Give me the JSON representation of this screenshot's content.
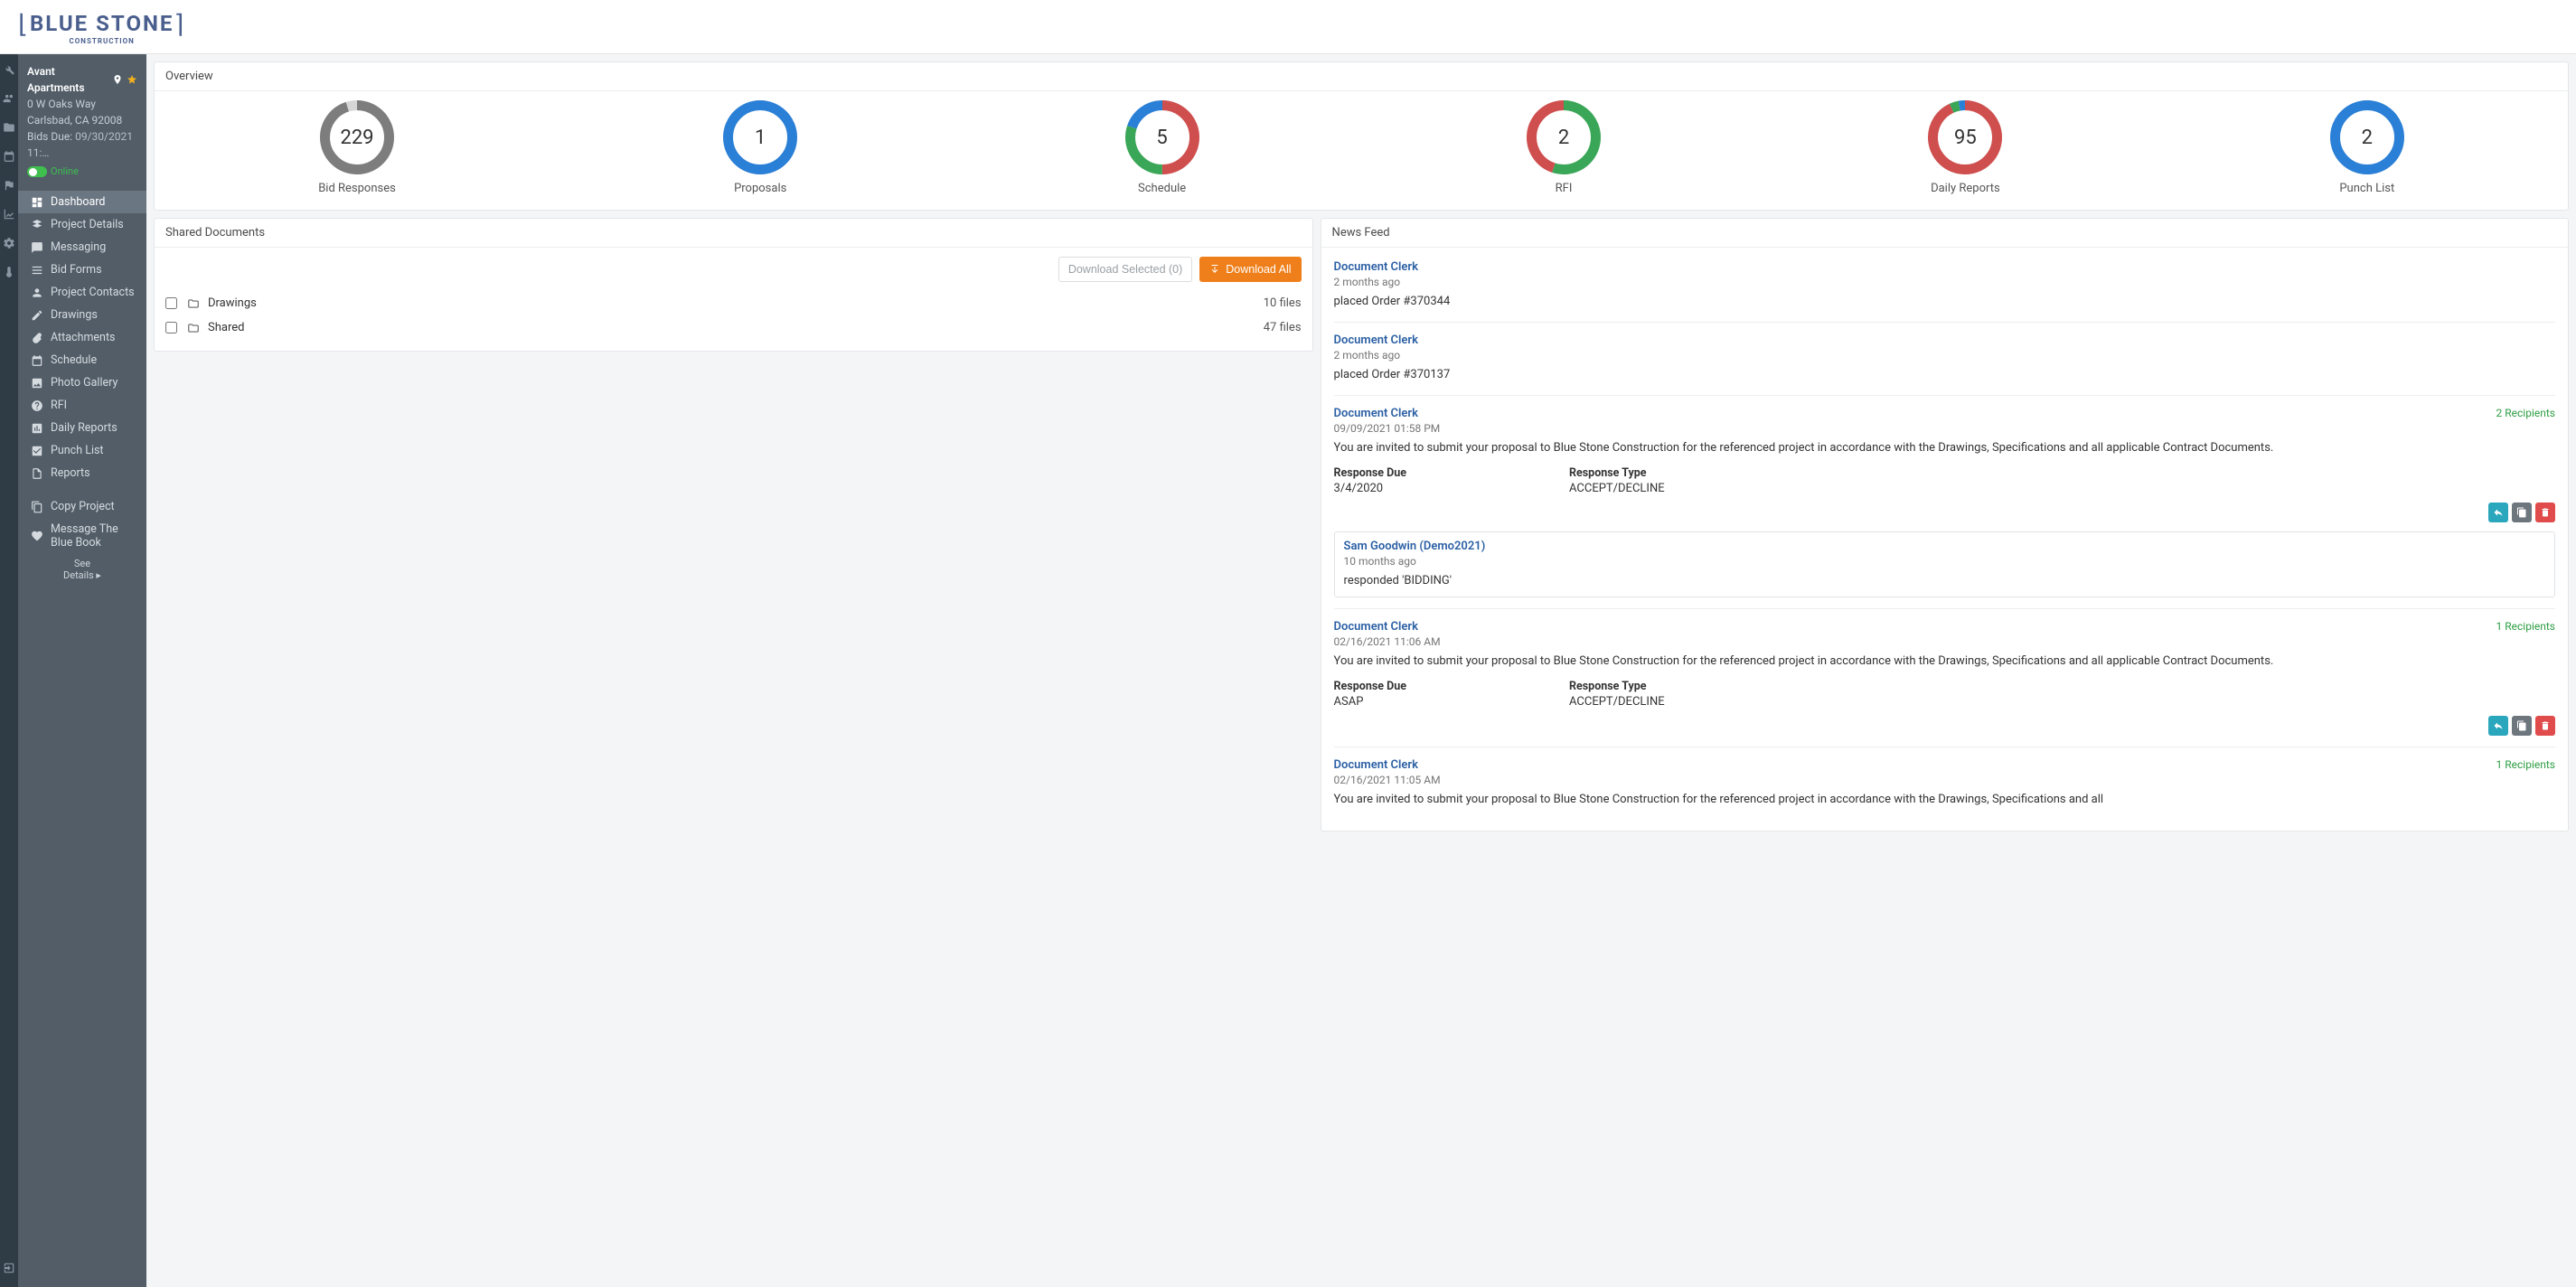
{
  "header": {
    "logo_main": "BLUE STONE",
    "logo_sub": "CONSTRUCTION"
  },
  "project": {
    "name": "Avant Apartments",
    "address1": "0 W Oaks Way",
    "address2": "Carlsbad, CA 92008",
    "bids_due_label": "Bids Due:",
    "bids_due_value": "09/30/2021 11:…",
    "online_label": "Online"
  },
  "nav": [
    {
      "id": "dashboard",
      "label": "Dashboard",
      "active": true
    },
    {
      "id": "project-details",
      "label": "Project Details"
    },
    {
      "id": "messaging",
      "label": "Messaging"
    },
    {
      "id": "bid-forms",
      "label": "Bid Forms"
    },
    {
      "id": "project-contacts",
      "label": "Project Contacts"
    },
    {
      "id": "drawings",
      "label": "Drawings"
    },
    {
      "id": "attachments",
      "label": "Attachments"
    },
    {
      "id": "schedule",
      "label": "Schedule"
    },
    {
      "id": "photo-gallery",
      "label": "Photo Gallery"
    },
    {
      "id": "rfi",
      "label": "RFI"
    },
    {
      "id": "daily-reports",
      "label": "Daily Reports"
    },
    {
      "id": "punch-list",
      "label": "Punch List"
    },
    {
      "id": "reports",
      "label": "Reports"
    }
  ],
  "nav_extra": [
    {
      "id": "copy-project",
      "label": "Copy Project"
    },
    {
      "id": "message-bluebook",
      "label": "Message The Blue Book"
    }
  ],
  "see_details": {
    "line1": "See",
    "line2": "Details ▸"
  },
  "overview": {
    "title": "Overview",
    "items": [
      {
        "value": "229",
        "label": "Bid Responses",
        "segments": [
          {
            "color": "#7d7d7d",
            "pct": 95
          },
          {
            "color": "#d6d6d6",
            "pct": 5
          }
        ]
      },
      {
        "value": "1",
        "label": "Proposals",
        "segments": [
          {
            "color": "#2a7fd6",
            "pct": 100
          }
        ]
      },
      {
        "value": "5",
        "label": "Schedule",
        "segments": [
          {
            "color": "#cf4e4e",
            "pct": 50
          },
          {
            "color": "#3aa657",
            "pct": 30
          },
          {
            "color": "#2a7fd6",
            "pct": 20
          }
        ]
      },
      {
        "value": "2",
        "label": "RFI",
        "segments": [
          {
            "color": "#3aa657",
            "pct": 55
          },
          {
            "color": "#cf4e4e",
            "pct": 45
          }
        ]
      },
      {
        "value": "95",
        "label": "Daily Reports",
        "segments": [
          {
            "color": "#cf4e4e",
            "pct": 93
          },
          {
            "color": "#3aa657",
            "pct": 4
          },
          {
            "color": "#2a7fd6",
            "pct": 3
          }
        ]
      },
      {
        "value": "2",
        "label": "Punch List",
        "segments": [
          {
            "color": "#2a7fd6",
            "pct": 100
          }
        ]
      }
    ]
  },
  "shared_docs": {
    "title": "Shared Documents",
    "download_selected": "Download Selected (0)",
    "download_all": "Download All",
    "rows": [
      {
        "name": "Drawings",
        "count": "10 files"
      },
      {
        "name": "Shared",
        "count": "47 files"
      }
    ]
  },
  "news_feed": {
    "title": "News Feed",
    "items": [
      {
        "author": "Document Clerk",
        "time": "2 months ago",
        "body": "placed Order #370344"
      },
      {
        "author": "Document Clerk",
        "time": "2 months ago",
        "body": "placed Order #370137"
      },
      {
        "author": "Document Clerk",
        "time": "09/09/2021 01:58 PM",
        "recipients": "2 Recipients",
        "body": "You are invited to submit your proposal to Blue Stone Construction for the referenced project in accordance with the Drawings, Specifications and all applicable Contract Documents.",
        "response_due_label": "Response Due",
        "response_due": "3/4/2020",
        "response_type_label": "Response Type",
        "response_type": "ACCEPT/DECLINE",
        "actions": true,
        "reply": {
          "author": "Sam Goodwin (Demo2021)",
          "time": "10 months ago",
          "body": "responded 'BIDDING'"
        }
      },
      {
        "author": "Document Clerk",
        "time": "02/16/2021 11:06 AM",
        "recipients": "1 Recipients",
        "body": "You are invited to submit your proposal to Blue Stone Construction for the referenced project in accordance with the Drawings, Specifications and all applicable Contract Documents.",
        "response_due_label": "Response Due",
        "response_due": "ASAP",
        "response_type_label": "Response Type",
        "response_type": "ACCEPT/DECLINE",
        "actions": true
      },
      {
        "author": "Document Clerk",
        "time": "02/16/2021 11:05 AM",
        "recipients": "1 Recipients",
        "body": "You are invited to submit your proposal to Blue Stone Construction for the referenced project in accordance with the Drawings, Specifications and all"
      }
    ]
  }
}
